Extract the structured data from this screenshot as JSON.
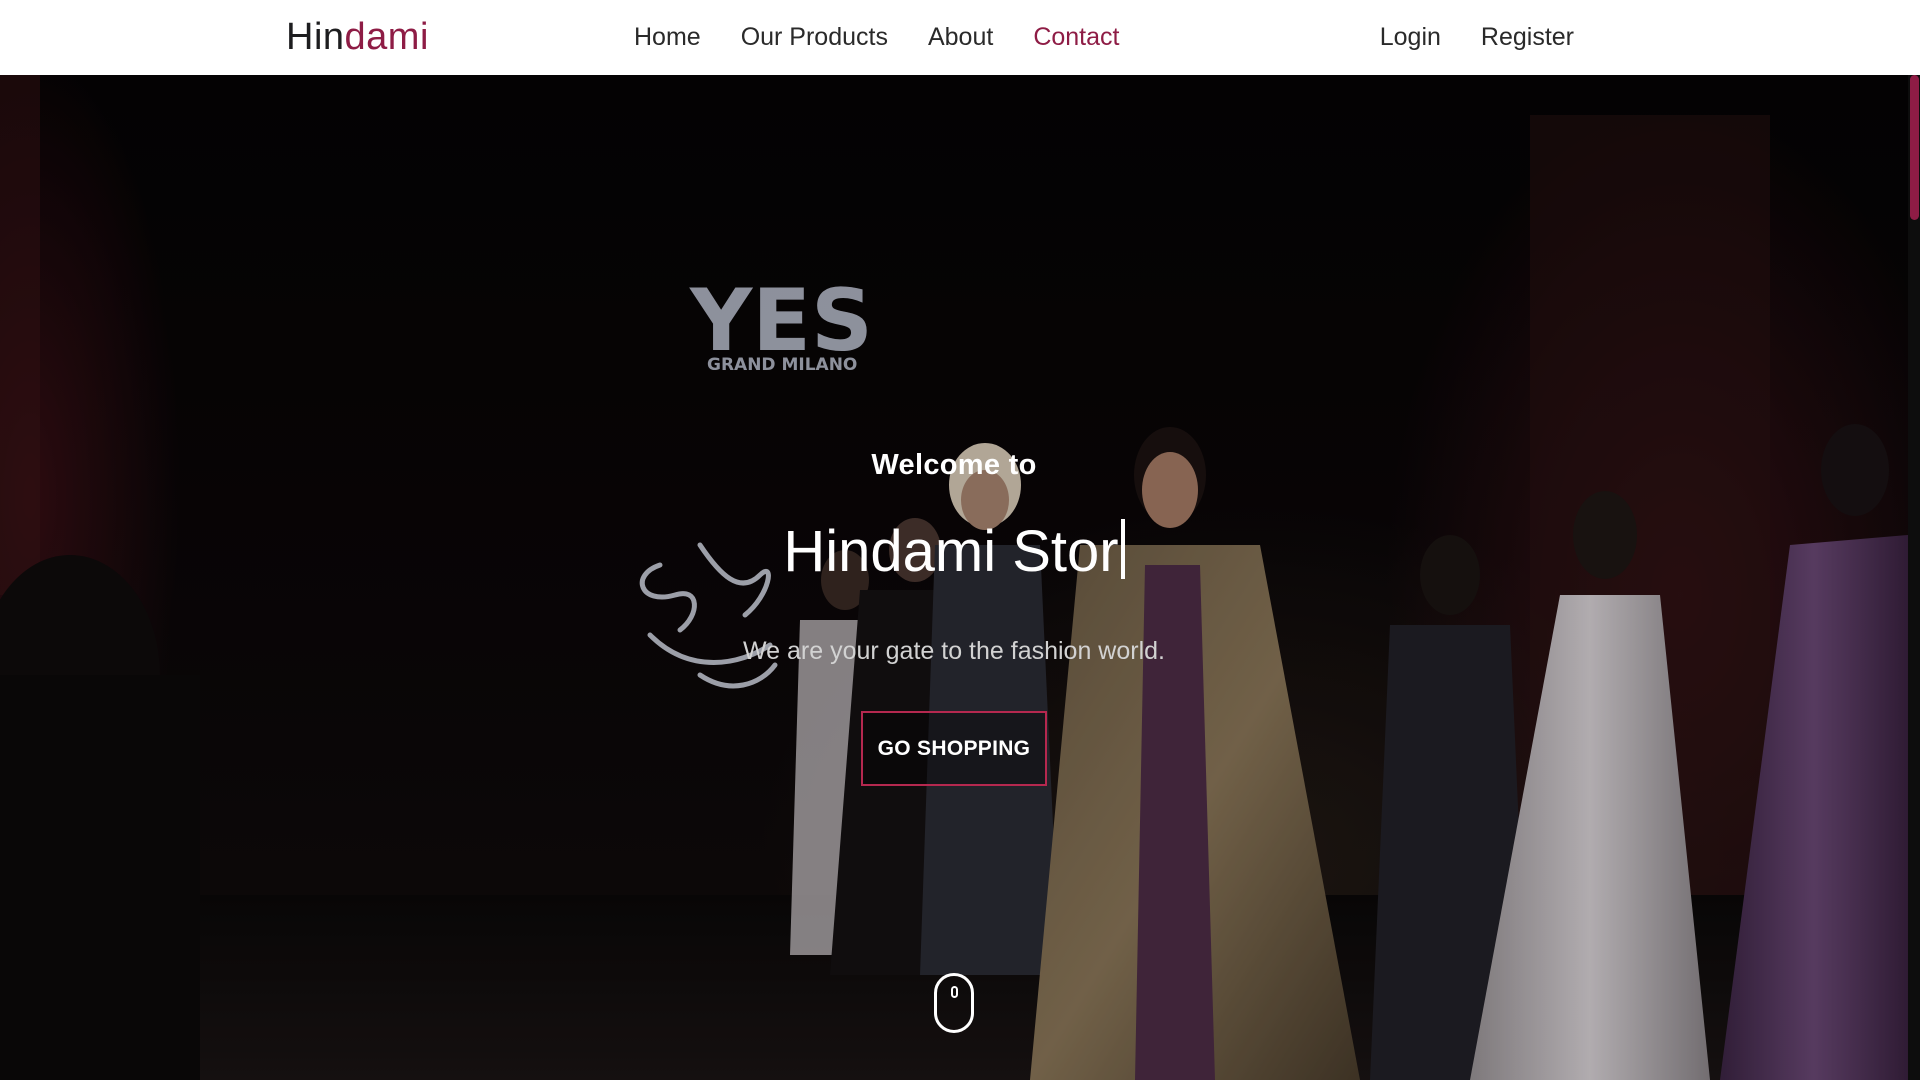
{
  "nav": {
    "brand_part1": "Hin",
    "brand_part2": "dami",
    "links": [
      {
        "label": "Home",
        "active": false
      },
      {
        "label": "Our Products",
        "active": false
      },
      {
        "label": "About",
        "active": false
      },
      {
        "label": "Contact",
        "active": true
      }
    ],
    "login": "Login",
    "register": "Register"
  },
  "hero": {
    "welcome": "Welcome to",
    "title": "Hindami Stor",
    "subtitle": "We are your gate to the fashion world.",
    "cta": "GO SHOPPING",
    "backdrop_logo_main": "YES",
    "backdrop_logo_sub": "GRAND MILANO"
  },
  "colors": {
    "accent": "#8e1c45",
    "button_border": "#b5284f",
    "nav_bg": "#ffffff",
    "text_dark": "#2a2a2a"
  },
  "icons": [
    "mouse-scroll-icon"
  ]
}
